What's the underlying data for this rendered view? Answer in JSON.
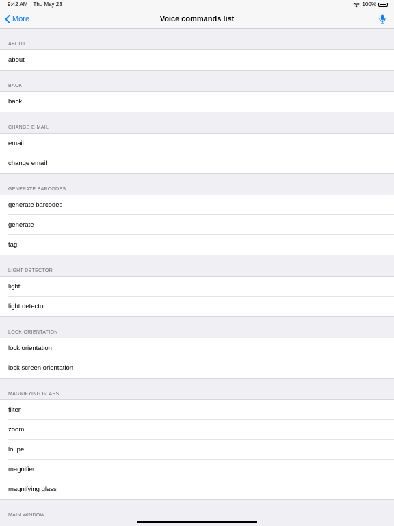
{
  "status_bar": {
    "time": "9:42 AM",
    "date": "Thu May 23",
    "battery_percent": "100%",
    "battery_level": 1.0
  },
  "nav": {
    "back_label": "More",
    "title": "Voice commands list",
    "accent_color": "#0a7aff"
  },
  "sections": [
    {
      "header": "ABOUT",
      "items": [
        "about"
      ]
    },
    {
      "header": "BACK",
      "items": [
        "back"
      ]
    },
    {
      "header": "CHANGE E-MAIL",
      "items": [
        "email",
        "change email"
      ]
    },
    {
      "header": "GENERATE BARCODES",
      "items": [
        "generate barcodes",
        "generate",
        "tag"
      ]
    },
    {
      "header": "LIGHT DETECTOR",
      "items": [
        "light",
        "light detector"
      ]
    },
    {
      "header": "LOCK ORIENTATION",
      "items": [
        "lock orientation",
        "lock screen orientation"
      ]
    },
    {
      "header": "MAGNIFYING GLASS",
      "items": [
        "filter",
        "zoom",
        "loupe",
        "magnifier",
        "magnifying glass"
      ]
    },
    {
      "header": "MAIN WINDOW",
      "items": []
    }
  ],
  "icons": {
    "back": "chevron-left-icon",
    "mic": "microphone-icon",
    "wifi": "wifi-icon",
    "battery": "battery-icon"
  }
}
